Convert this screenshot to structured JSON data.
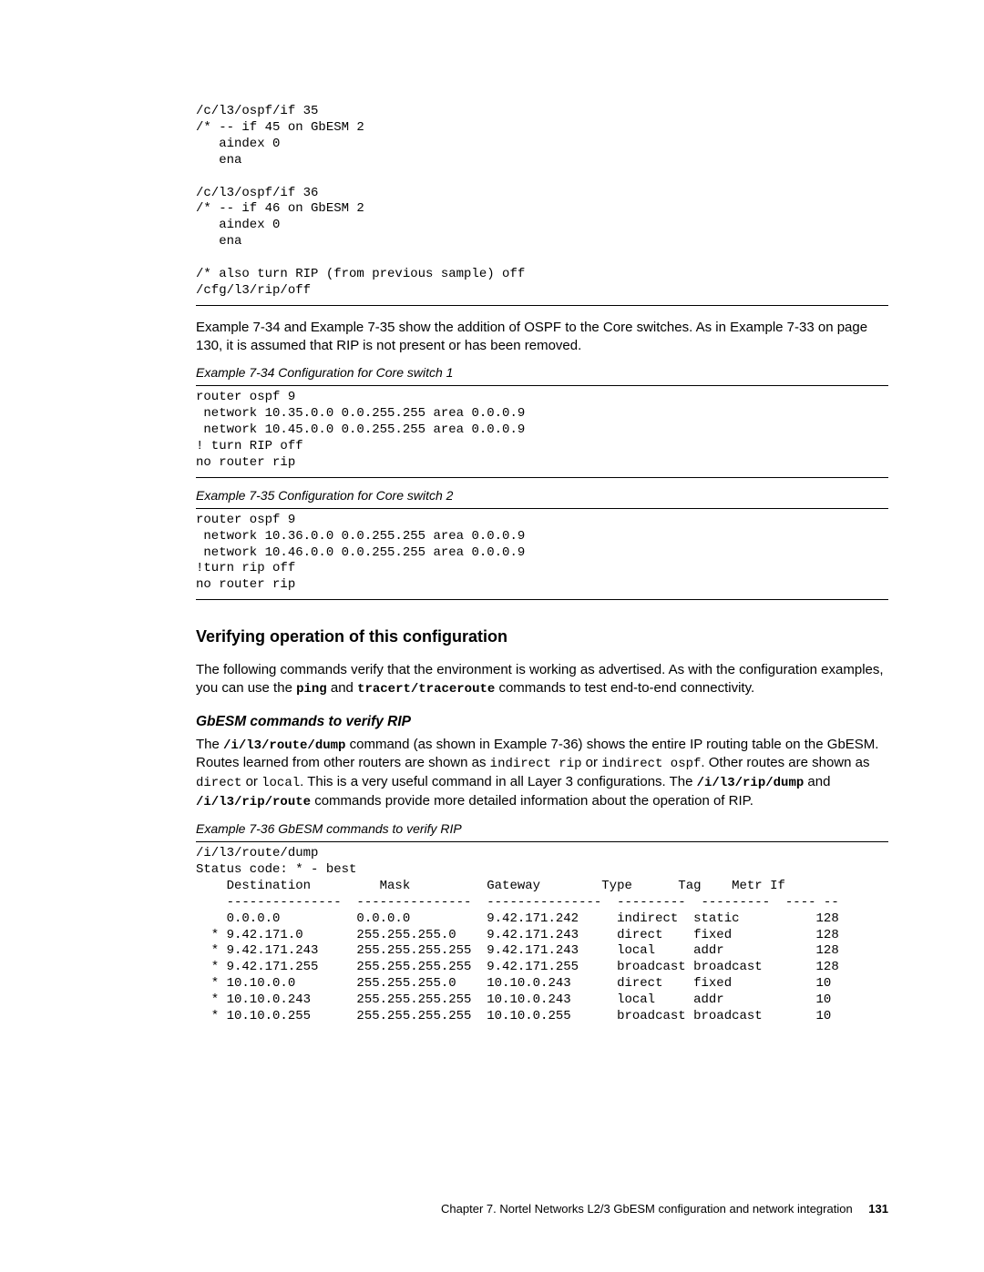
{
  "code1": "/c/l3/ospf/if 35\n/* -- if 45 on GbESM 2\n   aindex 0\n   ena\n\n/c/l3/ospf/if 36\n/* -- if 46 on GbESM 2\n   aindex 0\n   ena\n\n/* also turn RIP (from previous sample) off\n/cfg/l3/rip/off",
  "para1_a": "Example 7-34 and Example 7-35 show the addition of OSPF to the Core switches. As in Example 7-33 on page 130, it is assumed that RIP is not present or has been removed.",
  "ex34_caption": "Example 7-34   Configuration for Core switch 1",
  "code2": "router ospf 9\n network 10.35.0.0 0.0.255.255 area 0.0.0.9\n network 10.45.0.0 0.0.255.255 area 0.0.0.9\n! turn RIP off\nno router rip",
  "ex35_caption": "Example 7-35   Configuration for Core switch 2",
  "code3": "router ospf 9\n network 10.36.0.0 0.0.255.255 area 0.0.0.9\n network 10.46.0.0 0.0.255.255 area 0.0.0.9\n!turn rip off\nno router rip",
  "h2": "Verifying operation of this configuration",
  "para2_a": "The following commands verify that the environment is working as advertised. As with the configuration examples, you can use the ",
  "para2_cmd1": "ping",
  "para2_b": " and ",
  "para2_cmd2": "tracert/traceroute",
  "para2_c": " commands to test end-to-end connectivity.",
  "h3": "GbESM commands to verify RIP",
  "para3_a": "The ",
  "para3_cmd1": "/i/l3/route/dump",
  "para3_b": " command (as shown in Example 7-36) shows the entire IP routing table on the GbESM. Routes learned from other routers are shown as ",
  "para3_in1": "indirect rip",
  "para3_c": " or ",
  "para3_in2": "indirect ospf",
  "para3_d": ". Other routes are shown as ",
  "para3_in3": "direct",
  "para3_e": " or ",
  "para3_in4": "local",
  "para3_f": ". This is a very useful command in all Layer 3 configurations. The ",
  "para3_cmd2": "/i/l3/rip/dump",
  "para3_g": " and ",
  "para3_cmd3": "/i/l3/rip/route",
  "para3_h": " commands provide more detailed information about the operation of RIP.",
  "ex36_caption": "Example 7-36   GbESM commands to verify RIP",
  "code4": "/i/l3/route/dump\nStatus code: * - best\n    Destination         Mask          Gateway        Type      Tag    Metr If\n    ---------------  ---------------  ---------------  ---------  ---------  ---- --\n    0.0.0.0          0.0.0.0          9.42.171.242     indirect  static          128\n  * 9.42.171.0       255.255.255.0    9.42.171.243     direct    fixed           128\n  * 9.42.171.243     255.255.255.255  9.42.171.243     local     addr            128\n  * 9.42.171.255     255.255.255.255  9.42.171.255     broadcast broadcast       128\n  * 10.10.0.0        255.255.255.0    10.10.0.243      direct    fixed           10\n  * 10.10.0.243      255.255.255.255  10.10.0.243      local     addr            10\n  * 10.10.0.255      255.255.255.255  10.10.0.255      broadcast broadcast       10",
  "footer_chapter": "Chapter 7.  Nortel Networks L2/3 GbESM configuration and network integration",
  "footer_page": "131"
}
